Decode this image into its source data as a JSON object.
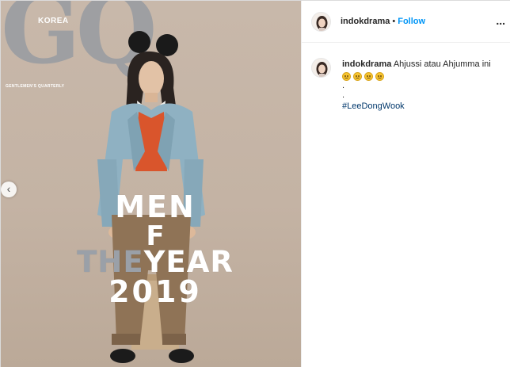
{
  "post": {
    "username": "indokdrama",
    "separator": "•",
    "follow_label": "Follow",
    "more_label": "...",
    "caption_text": "Ahjussi atau Ahjumma ini",
    "caption_dot_1": ".",
    "caption_dot_2": ".",
    "hashtag": "#LeeDongWook",
    "emojis": [
      "relieved-face-emoji",
      "confused-face-emoji",
      "frown-face-emoji",
      "grimace-face-emoji"
    ]
  },
  "cover": {
    "magazine_title": "GQ",
    "edition": "KOREA",
    "tagline": "GENTLEMEN'S QUARTERLY",
    "headline_line1": "MEN",
    "headline_line2": "F",
    "headline_line3_a": "THE",
    "headline_line3_b": "YEAR",
    "headline_line4": "2019"
  },
  "colors": {
    "follow": "#0095f6",
    "hashtag": "#00376b",
    "cover_bg": "#c6b6a7"
  },
  "icons": {
    "carousel_prev": "chevron-left-icon"
  }
}
